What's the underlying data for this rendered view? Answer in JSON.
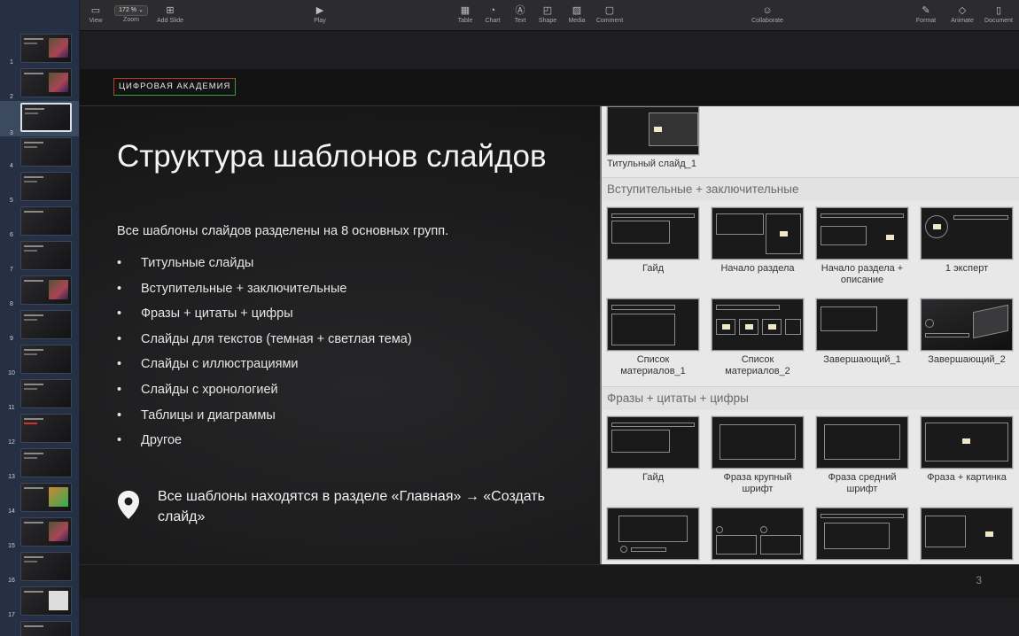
{
  "toolbar": {
    "view": "View",
    "zoom_value": "172 %",
    "zoom": "Zoom",
    "add_slide": "Add Slide",
    "play": "Play",
    "table": "Table",
    "chart": "Chart",
    "text": "Text",
    "shape": "Shape",
    "media": "Media",
    "comment": "Comment",
    "collaborate": "Collaborate",
    "format": "Format",
    "animate": "Animate",
    "document": "Document"
  },
  "sidebar": {
    "slides": [
      "1",
      "2",
      "3",
      "4",
      "5",
      "6",
      "7",
      "8",
      "9",
      "10",
      "11",
      "12",
      "13",
      "14",
      "15",
      "16",
      "17"
    ],
    "selected": "3"
  },
  "slide": {
    "brand": "ЦИФРОВАЯ АКАДЕМИЯ",
    "title": "Структура шаблонов слайдов",
    "intro": "Все шаблоны слайдов разделены на 8 основных групп.",
    "bullet_symbol": "•",
    "bullets": [
      "Титульные слайды",
      "Вступительные + заключительные",
      "Фразы + цитаты + цифры",
      "Слайды для текстов (темная + светлая тема)",
      "Слайды с иллюстрациями",
      "Слайды с хронологией",
      "Таблицы и диаграммы",
      "Другое"
    ],
    "footer_note": "Все шаблоны находятся в разделе «Главная» → «Создать слайд»",
    "number": "3"
  },
  "panel": {
    "title_label": "Титульный слайд_1",
    "section_intro": "Вступительные + заключительные",
    "intro_items": [
      "Гайд",
      "Начало раздела",
      "Начало раздела + описание",
      "1 эксперт",
      "Список материалов_1",
      "Список материалов_2",
      "Завершающий_1",
      "Завершающий_2"
    ],
    "section_phrases": "Фразы + цитаты + цифры",
    "phrase_items": [
      "Гайд",
      "Фраза крупный шрифт",
      "Фраза средний шрифт",
      "Фраза + картинка"
    ]
  }
}
